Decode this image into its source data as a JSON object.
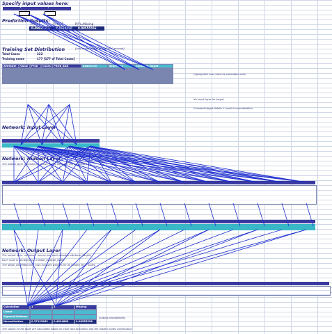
{
  "input": {
    "title": "Specify input values here:",
    "col1": "X",
    "col2": "Y"
  },
  "prediction": {
    "title": "Prediction Results:",
    "labels": [
      "P(Y)=1",
      "P(Y)=2",
      "P(Y)=Missing"
    ],
    "values": [
      "0.49951511",
      "0.4624888",
      "0.08555556"
    ]
  },
  "training": {
    "title": "Training Set Distribution",
    "note": "[only computation at 1000000 records]",
    "total_label": "Total Cases",
    "total_value": "222",
    "name_label": "Training name",
    "name_value": "177   [177 of Total Cases]"
  },
  "attrs": {
    "headers": [
      "Attribute",
      "Value",
      "Prob",
      "Cases",
      "PROB_BAR",
      "Score==0",
      "Score==1",
      "Constant Target"
    ],
    "note1": "Highlighted rows used as embedded cells",
    "note2": "No Input layer for target",
    "note3": "Constant target delete + used in normalization"
  },
  "network": {
    "input_title": "Network: Input Layer",
    "hidden_title": "Network: Hidden Layer",
    "output_title": "Network: Output Layer",
    "hidden_note": "The hidden layer calculations shown in this table will not be needed",
    "output_note1": "The output layer contains 1 neuron per each possible attribute (target)",
    "output_note2": "Each node is identified by a NODE_UNIQUE_NAME",
    "output_note3": "The NODE_DISTRIBUTION rows includes weights for all hidden layer nodes",
    "bottom_note": "The values in this table are calculated based on input and activation and the hidden nodes contribution",
    "result_label": "[output probabilities]"
  },
  "bottom": {
    "headers": [
      "Calculation",
      "1",
      "2",
      "Missing"
    ],
    "rows": [
      "Linear",
      "Sigmoid/Softmax",
      "Normalization"
    ],
    "values": [
      "0.37125962",
      "0.4624888",
      "0.08555556"
    ]
  }
}
